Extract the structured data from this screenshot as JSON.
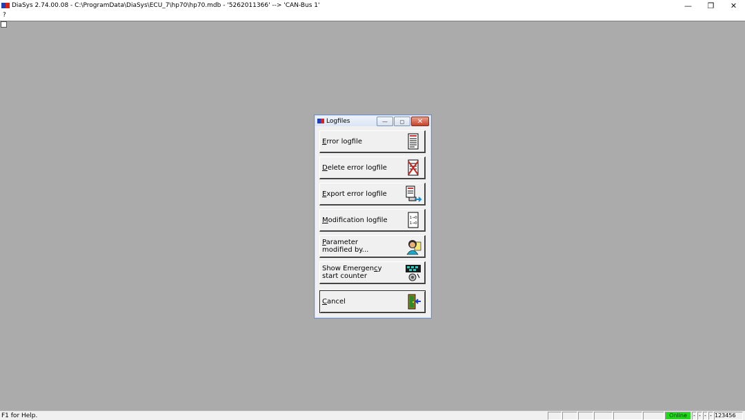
{
  "window": {
    "title": "DiaSys 2.74.00.08 - C:\\ProgramData\\DiaSys\\ECU_7\\hp70\\hp70.mdb - '5262011366' --> 'CAN-Bus 1'",
    "minimize": "—",
    "maximize": "❐",
    "close": "✕"
  },
  "menu": {
    "help": "?"
  },
  "dialog": {
    "title": "Logfiles",
    "minimize": "—",
    "restore": "◻",
    "close": "✕",
    "options": [
      {
        "line1": "Error logfile",
        "line2": "",
        "mnemonic": "E",
        "icon": "document-list-icon"
      },
      {
        "line1": "Delete error logfile",
        "line2": "",
        "mnemonic": "D",
        "icon": "document-delete-icon"
      },
      {
        "line1": "Export error logfile",
        "line2": "",
        "mnemonic": "E",
        "icon": "document-export-icon"
      },
      {
        "line1": "Modification logfile",
        "line2": "",
        "mnemonic": "M",
        "icon": "modification-list-icon"
      },
      {
        "line1": "Parameter",
        "line2": "modified by...",
        "mnemonic": "P",
        "icon": "person-icon"
      },
      {
        "line1": "Show Emergency",
        "line2": "start counter",
        "mnemonic": "c",
        "icon": "counter-icon"
      },
      {
        "line1": "Cancel",
        "line2": "",
        "mnemonic": "C",
        "icon": "exit-door-icon"
      }
    ]
  },
  "status": {
    "help": "F1 for Help.",
    "online": "Online",
    "p1": "-",
    "p2": "-",
    "p3": "-",
    "p4": "-",
    "number": "123456"
  },
  "colors": {
    "online": "#22d81b",
    "desktop": "#ababab"
  }
}
